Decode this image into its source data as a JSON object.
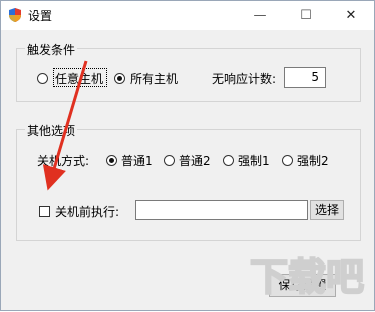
{
  "window": {
    "title": "设置",
    "controls": {
      "minimize": "—",
      "maximize": "☐",
      "close": "✕"
    }
  },
  "trigger_group": {
    "label": "触发条件",
    "option_any_host": "任意主机",
    "option_all_hosts": "所有主机",
    "selected": "所有主机",
    "timeout_label": "无响应计数:",
    "timeout_value": "5"
  },
  "other_group": {
    "label": "其他选项",
    "shutdown_mode_label": "关机方式:",
    "modes": [
      "普通1",
      "普通2",
      "强制1",
      "强制2"
    ],
    "selected_mode": "普通1",
    "pre_shutdown_label": "关机前执行:",
    "pre_shutdown_checked": false,
    "pre_shutdown_value": "",
    "browse_button": "选择"
  },
  "save_button": "保存设置",
  "annotation_color": "#e03020",
  "watermark": "下载吧"
}
